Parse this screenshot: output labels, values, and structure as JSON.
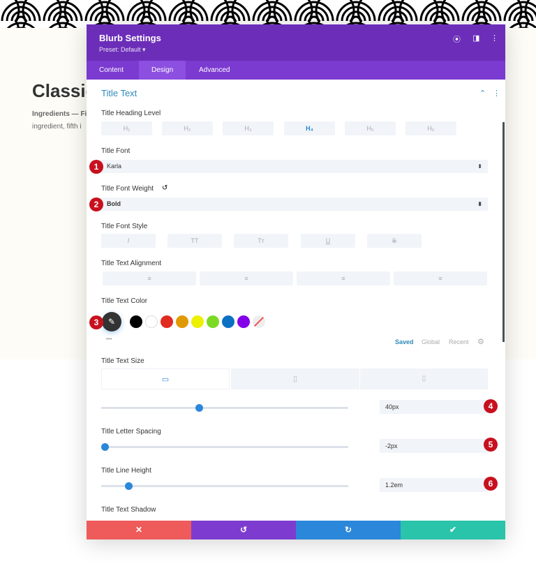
{
  "background": {
    "heading": "Classic",
    "text_line1": "Ingredients — Fi",
    "text_line2": "ingredient, fifth i"
  },
  "modal": {
    "title": "Blurb Settings",
    "preset": "Preset: Default ▾",
    "tabs": [
      {
        "label": "Content"
      },
      {
        "label": "Design"
      },
      {
        "label": "Advanced"
      }
    ],
    "active_tab": "Design",
    "section": "Title Text",
    "heading_level": {
      "label": "Title Heading Level",
      "options": [
        "H₁",
        "H₂",
        "H₃",
        "H₄",
        "H₅",
        "H₆"
      ],
      "selected": "H₄"
    },
    "font": {
      "label": "Title Font",
      "value": "Karla"
    },
    "weight": {
      "label": "Title Font Weight",
      "value": "Bold"
    },
    "style": {
      "label": "Title Font Style",
      "options": [
        "I",
        "TT",
        "Tт",
        "U",
        "S"
      ]
    },
    "alignment": {
      "label": "Title Text Alignment"
    },
    "color": {
      "label": "Title Text Color",
      "swatches": [
        "#000000",
        "#ffffff",
        "#e02b20",
        "#e09900",
        "#edf000",
        "#7cda24",
        "#0c71c3",
        "#8300e9"
      ],
      "more": "•••",
      "tabs": [
        "Saved",
        "Global",
        "Recent"
      ]
    },
    "size": {
      "label": "Title Text Size",
      "value": "40px",
      "fraction": 0.4
    },
    "letter_spacing": {
      "label": "Title Letter Spacing",
      "value": "-2px",
      "fraction": 0.0
    },
    "line_height": {
      "label": "Title Line Height",
      "value": "1.2em",
      "fraction": 0.11
    },
    "shadow": {
      "label": "Title Text Shadow"
    },
    "badges": [
      "1",
      "2",
      "3",
      "4",
      "5",
      "6"
    ],
    "footer": {
      "cancel": "✕",
      "undo": "↺",
      "redo": "↻",
      "save": "✔"
    },
    "colors": {
      "header": "#6c2eb9",
      "tabs": "#7b3ad0",
      "accent": "#2b87da",
      "cancel": "#ef5a5a",
      "undo": "#7e3bd0",
      "redo": "#2b87da",
      "save": "#29c4a9"
    }
  }
}
